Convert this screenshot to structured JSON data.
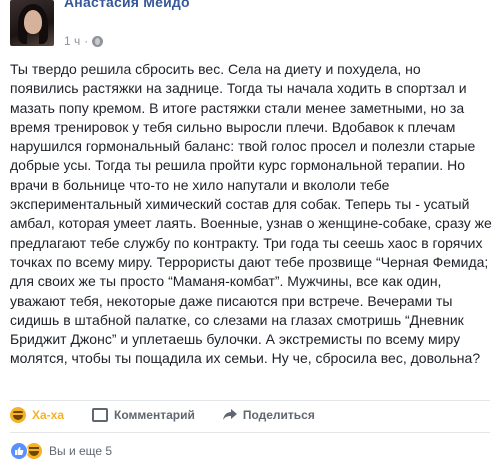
{
  "post": {
    "author_name": "Анастасия Мейдо",
    "timestamp": "1 ч",
    "separator": "·",
    "privacy_icon": "globe-icon",
    "text": "Ты твердо решила сбросить вес. Села на диету и похудела, но появились растяжки на заднице. Тогда ты начала ходить в спортзал и мазать попу кремом. В итоге растяжки стали менее заметными, но за время тренировок у тебя сильно выросли плечи. Вдобавок к плечам нарушился гормональный баланс: твой голос просел и полезли старые добрые усы. Тогда ты решила пройти курс гормональной терапии. Но врачи в больнице что-то не хило напутали и вкололи тебе экспериментальный химический состав для собак. Теперь ты - усатый амбал, которая умеет лаять. Военные, узнав о женщине-собаке, сразу же предлагают тебе службу по контракту. Три года ты сеешь хаос в горячих точках по всему миру. Террористы дают тебе прозвище “Черная Фемида; для своих же ты просто “Маманя-комбат”. Мужчины, все как один, уважают тебя, некоторые даже писаются при встрече. Вечерами ты сидишь в штабной палатке, со слезами на глазах смотришь “Дневник Бриджит Джонс” и уплетаешь булочки. А экстремисты по всему миру молятся, чтобы ты пощадила их семьи. Ну че, сбросила вес, довольна?"
  },
  "actions": {
    "reaction_label": "Ха-ха",
    "reaction_icon": "haha-emoji-icon",
    "comment_label": "Комментарий",
    "comment_icon": "comment-icon",
    "share_label": "Поделиться",
    "share_icon": "share-arrow-icon"
  },
  "reactions_summary": {
    "icons": [
      "like-icon",
      "haha-icon"
    ],
    "text": "Вы и еще 5"
  },
  "colors": {
    "author": "#365899",
    "haha": "#f7b125",
    "like": "#5890ff",
    "meta": "#90949c",
    "action_text": "#606770"
  }
}
